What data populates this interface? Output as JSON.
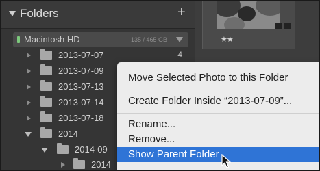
{
  "panel": {
    "title": "Folders",
    "add_icon": "plus-icon",
    "volume": {
      "name": "Macintosh HD",
      "space": "135 / 465 GB"
    },
    "folders": [
      {
        "label": "2013-07-07",
        "count": "4"
      },
      {
        "label": "2013-07-09",
        "count": ""
      },
      {
        "label": "2013-07-13",
        "count": ""
      },
      {
        "label": "2013-07-14",
        "count": ""
      },
      {
        "label": "2013-07-18",
        "count": ""
      },
      {
        "label": "2014",
        "count": ""
      },
      {
        "label": "2014-09",
        "count": ""
      },
      {
        "label": "2014",
        "count": ""
      }
    ]
  },
  "grid": {
    "rating": "★★"
  },
  "context_menu": {
    "items": [
      "Move Selected Photo to this Folder",
      "Create Folder Inside “2013-07-09”...",
      "Rename...",
      "Remove...",
      "Show Parent Folder"
    ],
    "selected": "Show Parent Folder"
  },
  "colors": {
    "panel_bg": "#353535",
    "menu_bg": "#ececec",
    "menu_highlight": "#2f74d6",
    "volume_led": "#7cc87c"
  }
}
